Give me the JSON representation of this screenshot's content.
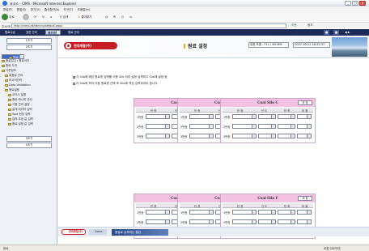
{
  "browser": {
    "title": "코크스 - CIMS - Microsoft Internet Explorer",
    "menu": [
      "파일(F)",
      "편집(E)",
      "보기(V)",
      "즐겨찾기(A)",
      "도구(T)",
      "도움말(H)"
    ],
    "toolbar": {
      "back": "뒤로",
      "search": "검색",
      "favorites": "즐겨찾기"
    },
    "address_label": "주소(D)",
    "address": "http://cims.dt/dev/cs/default.aspx",
    "go": "이동",
    "links": "링크"
  },
  "app_nav": [
    "원료수송",
    "표준 관리",
    "제조관리",
    "원료 관리"
  ],
  "sidebar": {
    "buttons": [
      "1조기",
      "2조기",
      "3조기",
      "4조기"
    ],
    "tree": [
      "원료관리",
      "원료입고 / 원료이관",
      "원료 사고",
      "기준정보",
      "설정값 관리",
      "보고서관리",
      "Data Validation",
      "원료설정",
      "원료설정",
      "코크스 설정",
      "원료 레시피 관리",
      "사용 관리 설정",
      "설계 데이터 입력",
      "Yard 현장 입력",
      "입력 추정 값 입력",
      "원료 설정 값 입력"
    ],
    "selected_index": 8
  },
  "header": {
    "logo": "현대제철(주)",
    "title": "원료 설정",
    "user": "장현 조원 - F11 / N5 MM",
    "date": "2007-10-21 18:32:37"
  },
  "notes": [
    "각 Silo에 해당 원료명 입력를 사용 Silo 처리 설정 입력하고 Silo에 설정 됨",
    "각 Silo에 적어 다음 원료명 선택 후 Silo에 적당 입력하셔야 됩니다."
  ],
  "panel_columns": [
    "탄 종",
    "년 도",
    "탄 좌",
    "비 율"
  ],
  "row_labels": [
    "1번종",
    "2번종",
    "3번종"
  ],
  "save_label": "저 장",
  "silos": [
    {
      "name": "Coal Silo A"
    },
    {
      "name": "Coal Silo B"
    },
    {
      "name": "Coal Silo C"
    },
    {
      "name": "Coal Silo D"
    },
    {
      "name": "Coal Silo E"
    },
    {
      "name": "Coal Silo F"
    }
  ],
  "footer": {
    "logo": "현대제철(주)",
    "logo2": "Cokes",
    "slogan": "품질로 승부하는 철강"
  },
  "status": {
    "left": "완료",
    "right": "로컬 인트라넷"
  },
  "colors": {
    "nav": "#1e2a58",
    "panel_head": "#f3c2e2",
    "brand": "#c61d23"
  }
}
